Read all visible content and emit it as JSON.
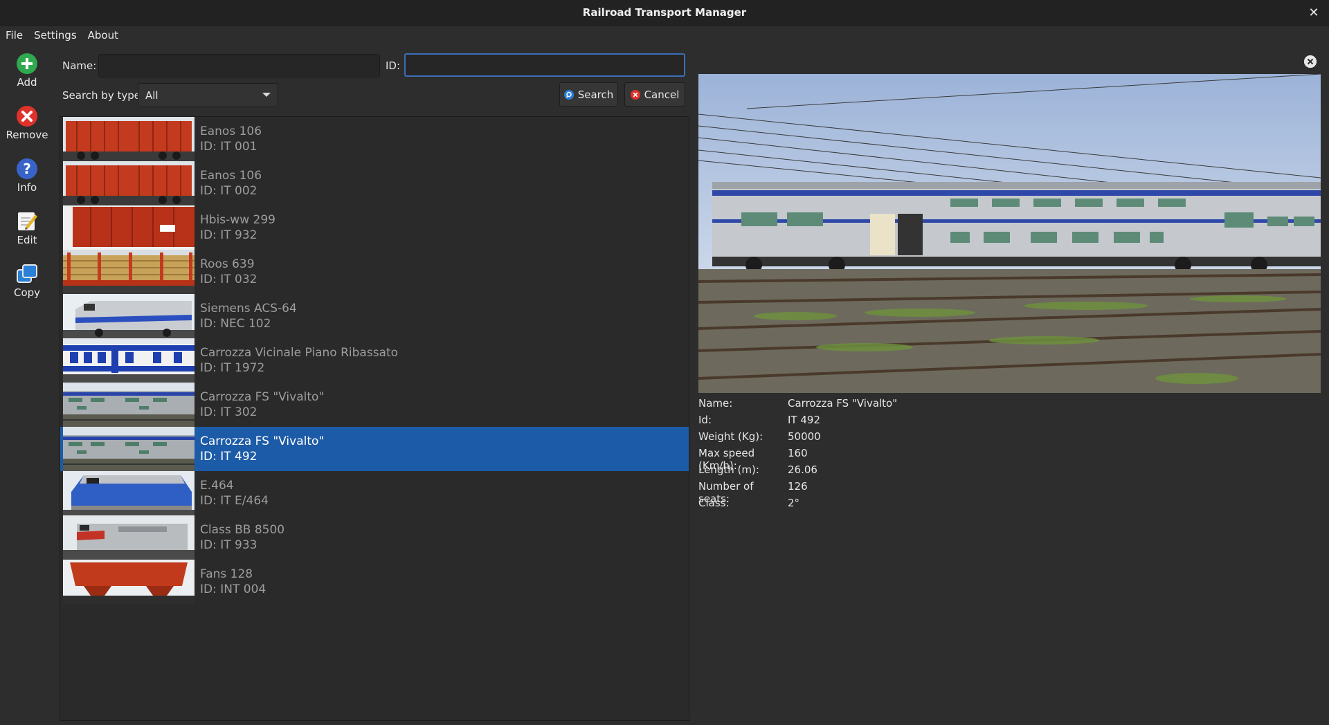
{
  "window": {
    "title": "Railroad Transport Manager",
    "close_glyph": "✕"
  },
  "menu": [
    {
      "id": "file",
      "label": "File"
    },
    {
      "id": "settings",
      "label": "Settings"
    },
    {
      "id": "about",
      "label": "About"
    }
  ],
  "toolbar": {
    "add": "Add",
    "remove": "Remove",
    "info": "Info",
    "edit": "Edit",
    "copy": "Copy"
  },
  "search": {
    "name_label": "Name:",
    "name_value": "",
    "id_label": "ID:",
    "id_value": "",
    "type_label": "Search by type:",
    "type_value": "All",
    "search_button": "Search",
    "cancel_button": "Cancel"
  },
  "items": [
    {
      "name": "Eanos 106",
      "id": "ID: IT 001",
      "thumb": "red-wagon",
      "selected": false
    },
    {
      "name": "Eanos 106",
      "id": "ID: IT 002",
      "thumb": "red-wagon",
      "selected": false
    },
    {
      "name": "Hbis-ww 299",
      "id": "ID: IT 932",
      "thumb": "red-boxcar",
      "selected": false
    },
    {
      "name": "Roos 639",
      "id": "ID: IT 032",
      "thumb": "log-wagon",
      "selected": false
    },
    {
      "name": "Siemens ACS-64",
      "id": "ID: NEC 102",
      "thumb": "silver-loco",
      "selected": false
    },
    {
      "name": "Carrozza Vicinale Piano Ribassato",
      "id": "ID: IT 1972",
      "thumb": "blue-coach",
      "selected": false
    },
    {
      "name": "Carrozza FS \"Vivalto\"",
      "id": "ID: IT 302",
      "thumb": "vivalto",
      "selected": false
    },
    {
      "name": "Carrozza FS \"Vivalto\"",
      "id": "ID: IT 492",
      "thumb": "vivalto",
      "selected": true
    },
    {
      "name": "E.464",
      "id": "ID: IT E/464",
      "thumb": "blue-loco",
      "selected": false
    },
    {
      "name": "Class BB 8500",
      "id": "ID: IT 933",
      "thumb": "grey-loco",
      "selected": false
    },
    {
      "name": "Fans 128",
      "id": "ID: INT 004",
      "thumb": "red-hopper",
      "selected": false
    }
  ],
  "detail": {
    "fields": [
      {
        "key": "Name:",
        "value": "Carrozza FS \"Vivalto\""
      },
      {
        "key": "Id:",
        "value": "IT 492"
      },
      {
        "key": "Weight (Kg):",
        "value": "50000"
      },
      {
        "key": "Max speed (Km/h):",
        "value": "160"
      },
      {
        "key": "Length (m):",
        "value": "26.06"
      },
      {
        "key": "Number of seats:",
        "value": "126"
      },
      {
        "key": "Class:",
        "value": "2°"
      }
    ]
  },
  "colors": {
    "selection": "#1c5ba7",
    "background": "#2d2d2d",
    "focus_border": "#3b6fb6"
  }
}
